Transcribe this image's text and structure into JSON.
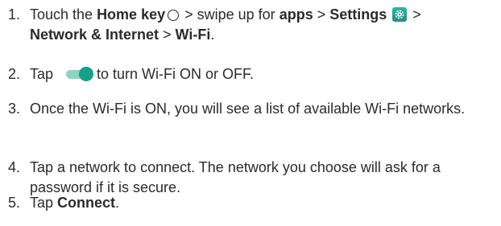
{
  "steps": [
    {
      "number": "1.",
      "t1": "Touch the ",
      "home_key": "Home key",
      "t2": " > swipe up for ",
      "apps": "apps",
      "t3": " > ",
      "settings": "Settings",
      "t4": " > ",
      "network": "Network & Internet",
      "t5": " > ",
      "wifi": "Wi-Fi",
      "t6": "."
    },
    {
      "number": "2.",
      "t1": "Tap",
      "t2": "to turn Wi-Fi ON or OFF."
    },
    {
      "number": "3.",
      "text": "Once the Wi-Fi is ON, you will see a list of available Wi-Fi networks."
    },
    {
      "number": "4.",
      "text": "Tap a network to connect. The network you choose will ask for a password if it is secure."
    },
    {
      "number": "5.",
      "t1": "Tap ",
      "connect": "Connect",
      "t2": "."
    }
  ],
  "icons": {
    "home": "home-key-circle-icon",
    "settings": "settings-gear-icon",
    "toggle": "wifi-toggle-icon"
  },
  "colors": {
    "text": "#2b2b2b",
    "settings_icon": "#2a9d8f",
    "toggle_knob": "#16a085",
    "toggle_track": "#8fd3c4"
  }
}
